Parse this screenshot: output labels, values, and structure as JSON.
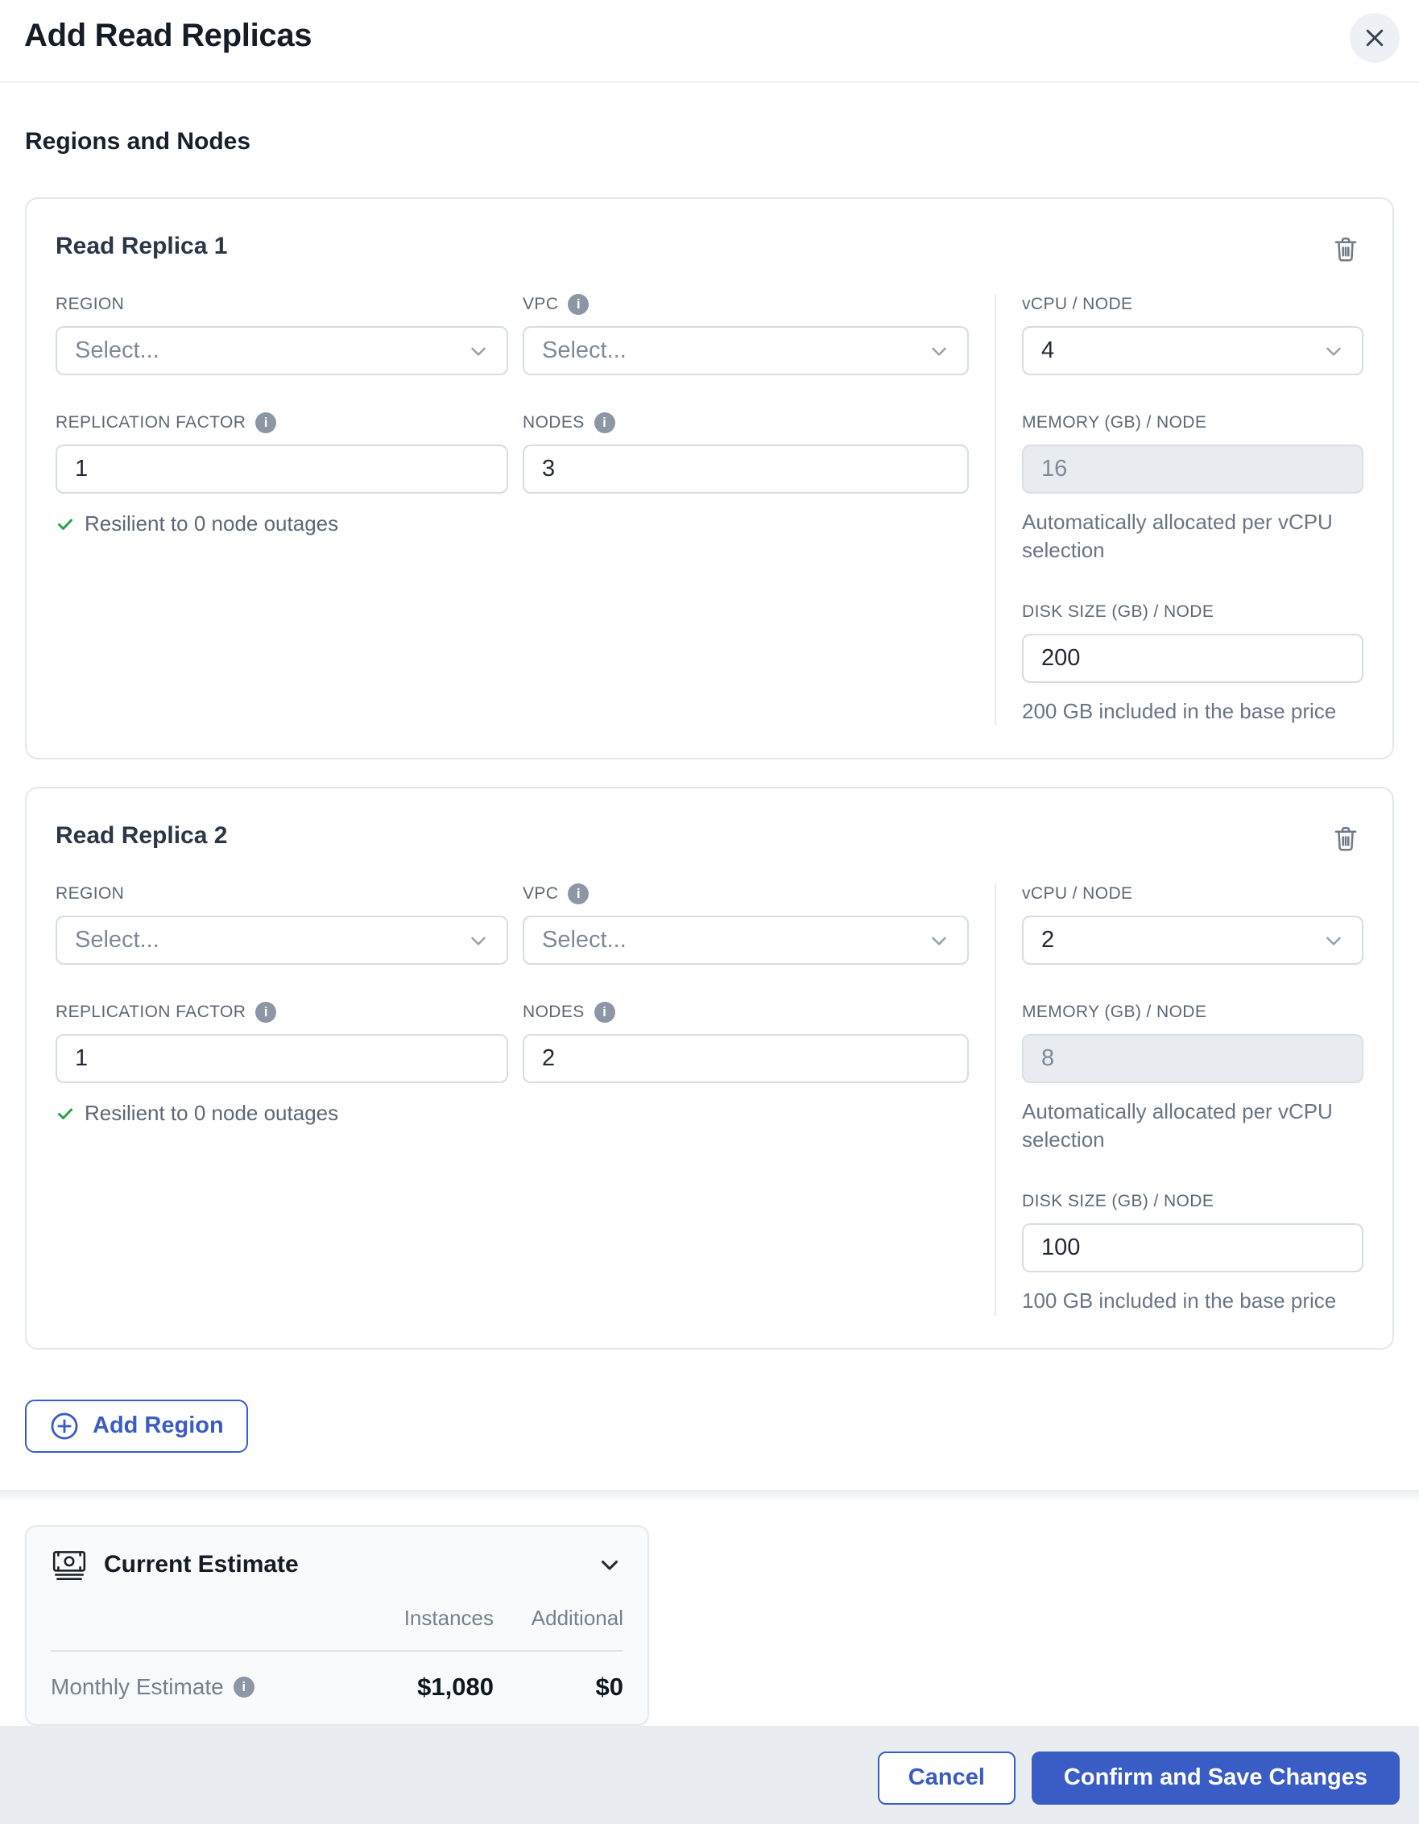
{
  "header": {
    "title": "Add Read Replicas"
  },
  "section_title": "Regions and Nodes",
  "labels": {
    "region": "REGION",
    "vpc": "VPC",
    "vcpu": "vCPU / NODE",
    "replication_factor": "REPLICATION FACTOR",
    "nodes": "NODES",
    "memory": "MEMORY (GB) / NODE",
    "disk": "DISK SIZE (GB) / NODE"
  },
  "replicas": [
    {
      "title": "Read Replica 1",
      "region_placeholder": "Select...",
      "vpc_placeholder": "Select...",
      "vcpu": "4",
      "replication_factor": "1",
      "nodes": "3",
      "memory": "16",
      "disk": "200",
      "resilience_text": "Resilient to 0 node outages",
      "memory_helper": "Automatically allocated per vCPU selection",
      "disk_helper": "200 GB included in the base price"
    },
    {
      "title": "Read Replica 2",
      "region_placeholder": "Select...",
      "vpc_placeholder": "Select...",
      "vcpu": "2",
      "replication_factor": "1",
      "nodes": "2",
      "memory": "8",
      "disk": "100",
      "resilience_text": "Resilient to 0 node outages",
      "memory_helper": "Automatically allocated per vCPU selection",
      "disk_helper": "100 GB included in the base price"
    }
  ],
  "add_region_label": "Add Region",
  "estimate": {
    "title": "Current Estimate",
    "col_instances": "Instances",
    "col_additional": "Additional",
    "row_label": "Monthly Estimate",
    "instances_value": "$1,080",
    "additional_value": "$0"
  },
  "footer": {
    "cancel_label": "Cancel",
    "confirm_label": "Confirm and Save Changes"
  },
  "colors": {
    "accent_blue": "#3a5cc5",
    "success_green": "#2aa14a",
    "footer_bg": "#e9edf2",
    "card_border": "#e3e8ee"
  }
}
